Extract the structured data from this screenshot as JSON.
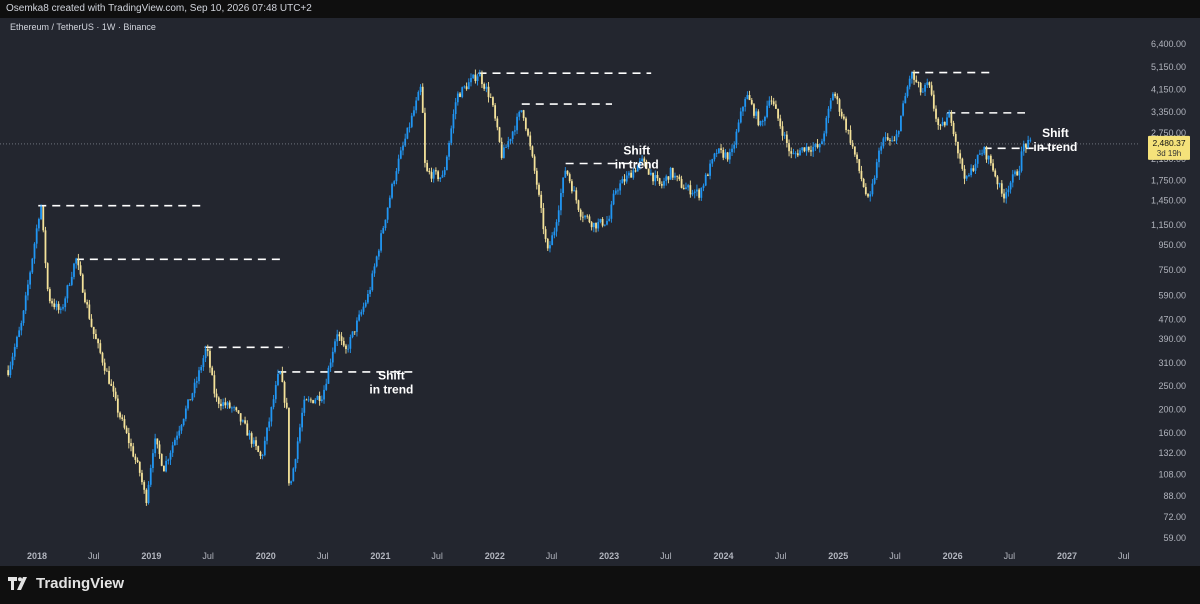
{
  "header": {
    "credit": "Osemka8 created with TradingView.com, Sep 10, 2026 07:48 UTC+2"
  },
  "footer": {
    "brand": "TradingView"
  },
  "chart_data": {
    "type": "candlestick",
    "title": "Ethereum / TetherUS · 1W · Binance",
    "scale": "log",
    "grid": false,
    "yticks": [
      "6,400.00",
      "5,150.00",
      "4,150.00",
      "3,350.00",
      "2,750.00",
      "2,150.00",
      "1,750.00",
      "1,450.00",
      "1,150.00",
      "950.00",
      "750.00",
      "590.00",
      "470.00",
      "390.00",
      "310.00",
      "250.00",
      "200.00",
      "160.00",
      "132.00",
      "108.00",
      "88.00",
      "72.00",
      "59.00"
    ],
    "xticks": [
      "2018",
      "Jul",
      "2019",
      "Jul",
      "2020",
      "Jul",
      "2021",
      "Jul",
      "2022",
      "Jul",
      "2023",
      "Jul",
      "2024",
      "Jul",
      "2025",
      "Jul",
      "2026",
      "Jul",
      "2027",
      "Jul"
    ],
    "last_price": "2,480.37",
    "countdown": "3d 19h",
    "colors": {
      "up": "#2196f3",
      "down": "#f4e29a",
      "background": "#23262f",
      "axis_text": "#b2b5be"
    },
    "price_path": [
      [
        "2017-10-01",
        290
      ],
      [
        "2017-11-15",
        460
      ],
      [
        "2018-01-13",
        1420
      ],
      [
        "2018-02-06",
        580
      ],
      [
        "2018-03-18",
        500
      ],
      [
        "2018-05-05",
        840
      ],
      [
        "2018-06-28",
        420
      ],
      [
        "2018-08-15",
        275
      ],
      [
        "2018-09-15",
        200
      ],
      [
        "2018-11-25",
        110
      ],
      [
        "2018-12-15",
        84
      ],
      [
        "2019-01-10",
        150
      ],
      [
        "2019-02-10",
        115
      ],
      [
        "2019-04-01",
        170
      ],
      [
        "2019-05-25",
        260
      ],
      [
        "2019-06-26",
        360
      ],
      [
        "2019-07-25",
        220
      ],
      [
        "2019-09-20",
        200
      ],
      [
        "2019-10-25",
        170
      ],
      [
        "2019-12-18",
        125
      ],
      [
        "2020-02-14",
        290
      ],
      [
        "2020-03-10",
        190
      ],
      [
        "2020-03-16",
        90
      ],
      [
        "2020-05-01",
        210
      ],
      [
        "2020-07-01",
        230
      ],
      [
        "2020-08-15",
        420
      ],
      [
        "2020-09-10",
        340
      ],
      [
        "2020-11-25",
        600
      ],
      [
        "2021-01-20",
        1300
      ],
      [
        "2021-02-20",
        1950
      ],
      [
        "2021-05-12",
        4300
      ],
      [
        "2021-05-24",
        1900
      ],
      [
        "2021-07-20",
        1800
      ],
      [
        "2021-09-01",
        3900
      ],
      [
        "2021-11-10",
        4850
      ],
      [
        "2021-12-20",
        3800
      ],
      [
        "2022-01-24",
        2200
      ],
      [
        "2022-03-30",
        3500
      ],
      [
        "2022-05-12",
        1800
      ],
      [
        "2022-06-18",
        880
      ],
      [
        "2022-07-10",
        1100
      ],
      [
        "2022-08-15",
        1980
      ],
      [
        "2022-10-01",
        1300
      ],
      [
        "2022-11-15",
        1150
      ],
      [
        "2022-12-31",
        1200
      ],
      [
        "2023-01-20",
        1600
      ],
      [
        "2023-04-15",
        2100
      ],
      [
        "2023-06-15",
        1650
      ],
      [
        "2023-07-15",
        1900
      ],
      [
        "2023-08-25",
        1650
      ],
      [
        "2023-10-15",
        1550
      ],
      [
        "2023-12-10",
        2300
      ],
      [
        "2024-01-25",
        2200
      ],
      [
        "2024-03-12",
        4000
      ],
      [
        "2024-05-01",
        2900
      ],
      [
        "2024-05-27",
        3950
      ],
      [
        "2024-08-05",
        2200
      ],
      [
        "2024-09-15",
        2400
      ],
      [
        "2024-11-05",
        2400
      ],
      [
        "2024-12-16",
        4100
      ],
      [
        "2025-02-05",
        2700
      ],
      [
        "2025-03-10",
        1900
      ],
      [
        "2025-04-09",
        1400
      ],
      [
        "2025-05-20",
        2600
      ],
      [
        "2025-07-01",
        2500
      ],
      [
        "2025-08-20",
        4850
      ],
      [
        "2025-09-25",
        4000
      ],
      [
        "2025-10-15",
        4400
      ],
      [
        "2025-11-20",
        2800
      ],
      [
        "2025-12-25",
        3300
      ],
      [
        "2026-01-25",
        2100
      ],
      [
        "2026-02-15",
        1750
      ],
      [
        "2026-03-15",
        2100
      ],
      [
        "2026-04-10",
        2350
      ],
      [
        "2026-05-05",
        2050
      ],
      [
        "2026-06-10",
        1500
      ],
      [
        "2026-07-01",
        1700
      ],
      [
        "2026-07-31",
        1950
      ],
      [
        "2026-08-15",
        2450
      ],
      [
        "2026-09-10",
        2480
      ]
    ],
    "levels": [
      {
        "price": 1380,
        "from": "2018-01-05",
        "to": "2019-06-10"
      },
      {
        "price": 830,
        "from": "2018-05-05",
        "to": "2020-03-01"
      },
      {
        "price": 360,
        "from": "2019-06-20",
        "to": "2020-03-15"
      },
      {
        "price": 285,
        "from": "2020-02-10",
        "to": "2021-04-15"
      },
      {
        "price": 4850,
        "from": "2021-11-10",
        "to": "2023-05-15"
      },
      {
        "price": 3620,
        "from": "2022-03-28",
        "to": "2023-01-10"
      },
      {
        "price": 2060,
        "from": "2022-08-15",
        "to": "2023-04-01"
      },
      {
        "price": 4880,
        "from": "2025-08-22",
        "to": "2026-05-05"
      },
      {
        "price": 3330,
        "from": "2025-12-15",
        "to": "2026-08-20"
      },
      {
        "price": 2380,
        "from": "2026-04-10",
        "to": "2026-11-25"
      }
    ],
    "annotations": [
      {
        "text": [
          "Shift",
          "in trend"
        ],
        "date": "2021-02-05",
        "price": 265
      },
      {
        "text": [
          "Shift",
          "in trend"
        ],
        "date": "2023-03-30",
        "price": 2240
      },
      {
        "text": [
          "Shift",
          "in trend"
        ],
        "date": "2026-11-25",
        "price": 2650
      }
    ]
  }
}
